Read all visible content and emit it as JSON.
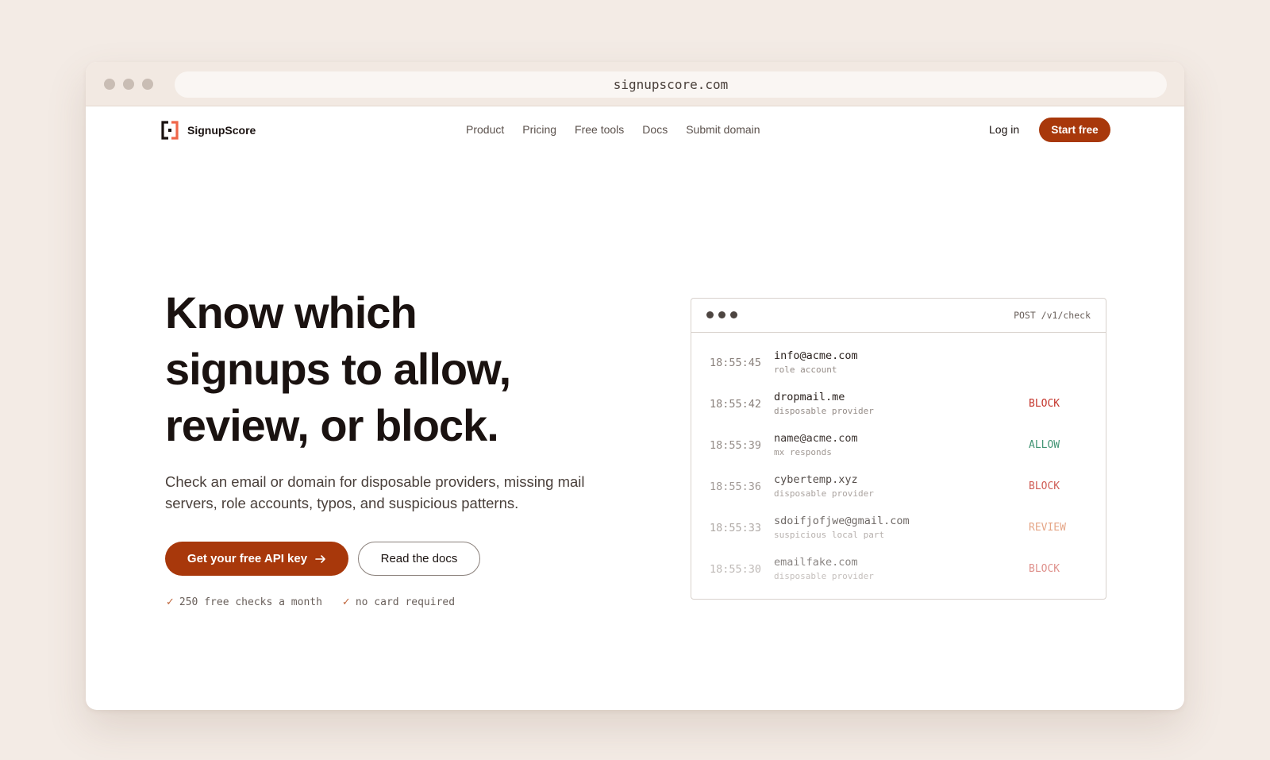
{
  "browser": {
    "url": "signupscore.com"
  },
  "nav": {
    "brand": "SignupScore",
    "links": [
      "Product",
      "Pricing",
      "Free tools",
      "Docs",
      "Submit domain"
    ],
    "login": "Log in",
    "cta": "Start free"
  },
  "hero": {
    "title_line1": "Know which",
    "title_line2": "signups to allow,",
    "title_line3": "review, or block.",
    "subtitle": "Check an email or domain for disposable providers, missing mail servers, role accounts, typos, and suspicious patterns.",
    "primary_button": "Get your free API key",
    "secondary_button": "Read the docs",
    "check1": "250 free checks a month",
    "check2": "no card required"
  },
  "panel": {
    "endpoint": "POST /v1/check",
    "rows": [
      {
        "time": "18:55:45",
        "email": "info@acme.com",
        "reason": "role account",
        "verdict": "",
        "opacity": 1.0
      },
      {
        "time": "18:55:42",
        "email": "dropmail.me",
        "reason": "disposable provider",
        "verdict": "BLOCK",
        "opacity": 1.0
      },
      {
        "time": "18:55:39",
        "email": "name@acme.com",
        "reason": "mx responds",
        "verdict": "ALLOW",
        "opacity": 0.9
      },
      {
        "time": "18:55:36",
        "email": "cybertemp.xyz",
        "reason": "disposable provider",
        "verdict": "BLOCK",
        "opacity": 0.8
      },
      {
        "time": "18:55:33",
        "email": "sdoifjofjwe@gmail.com",
        "reason": "suspicious local part",
        "verdict": "REVIEW",
        "opacity": 0.68
      },
      {
        "time": "18:55:30",
        "email": "emailfake.com",
        "reason": "disposable provider",
        "verdict": "BLOCK",
        "opacity": 0.55
      }
    ]
  },
  "colors": {
    "accent": "#a8380b",
    "block": "#c4342b",
    "allow": "#2e8a66",
    "review": "#d97c4e",
    "page_bg": "#f3ebe5"
  }
}
